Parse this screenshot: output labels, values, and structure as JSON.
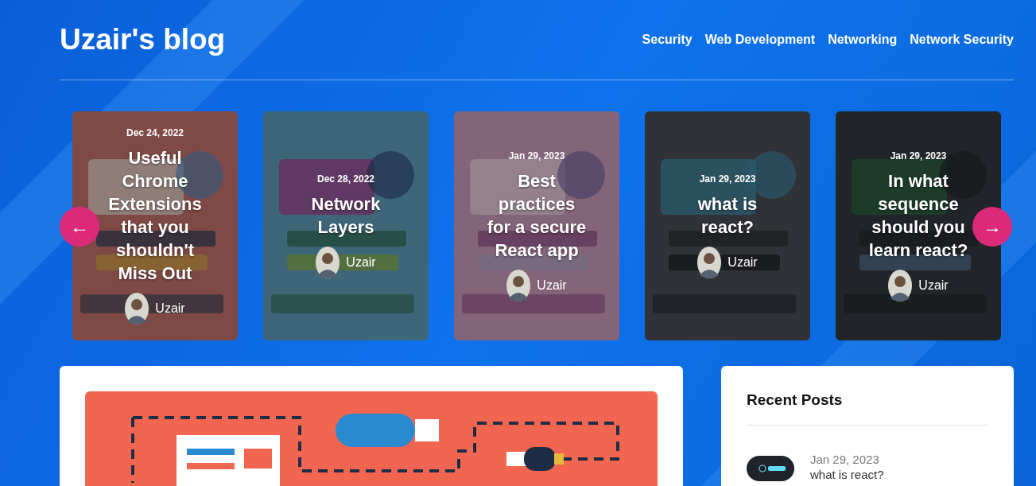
{
  "blog_title": "Uzair's blog",
  "nav": [
    "Security",
    "Web Development",
    "Networking",
    "Network Security"
  ],
  "carousel": {
    "prev": "←",
    "next": "→",
    "cards": [
      {
        "date": "Dec 24, 2022",
        "title": "Useful Chrome Extensions that you shouldn't Miss Out",
        "author": "Uzair"
      },
      {
        "date": "Dec 28, 2022",
        "title": "Network Layers",
        "author": "Uzair"
      },
      {
        "date": "Jan 29, 2023",
        "title": "Best practices for a secure React app",
        "author": "Uzair"
      },
      {
        "date": "Jan 29, 2023",
        "title": "what is react?",
        "author": "Uzair"
      },
      {
        "date": "Jan 29, 2023",
        "title": "In what sequence should you learn react?",
        "author": "Uzair"
      }
    ]
  },
  "recent_posts": {
    "heading": "Recent Posts",
    "items": [
      {
        "date": "Jan 29, 2023",
        "title": "what is react?"
      }
    ]
  }
}
